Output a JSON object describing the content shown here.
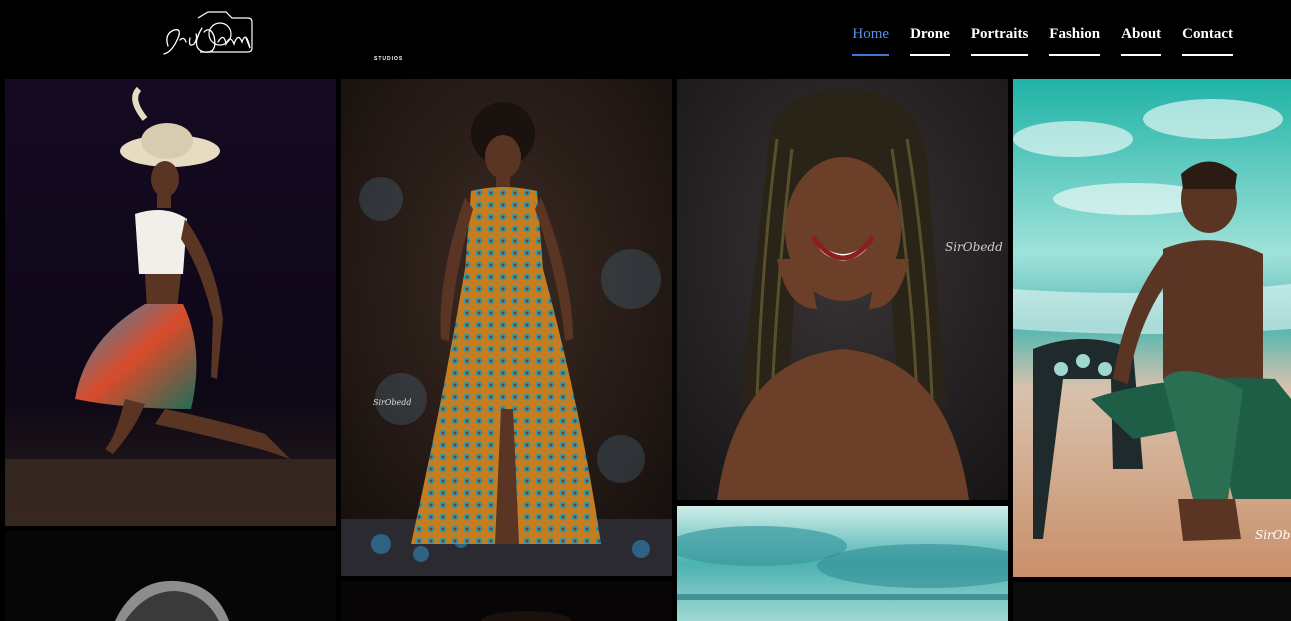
{
  "brand": {
    "name": "SirObedd",
    "subtitle": "STUDIOS",
    "logo_icon": "camera-signature-logo"
  },
  "nav": {
    "items": [
      {
        "label": "Home",
        "active": true
      },
      {
        "label": "Drone",
        "active": false
      },
      {
        "label": "Portraits",
        "active": false
      },
      {
        "label": "Fashion",
        "active": false
      },
      {
        "label": "About",
        "active": false
      },
      {
        "label": "Contact",
        "active": false
      }
    ],
    "active_color": "#3b78d8"
  },
  "gallery": {
    "watermark": "SirObedd"
  }
}
